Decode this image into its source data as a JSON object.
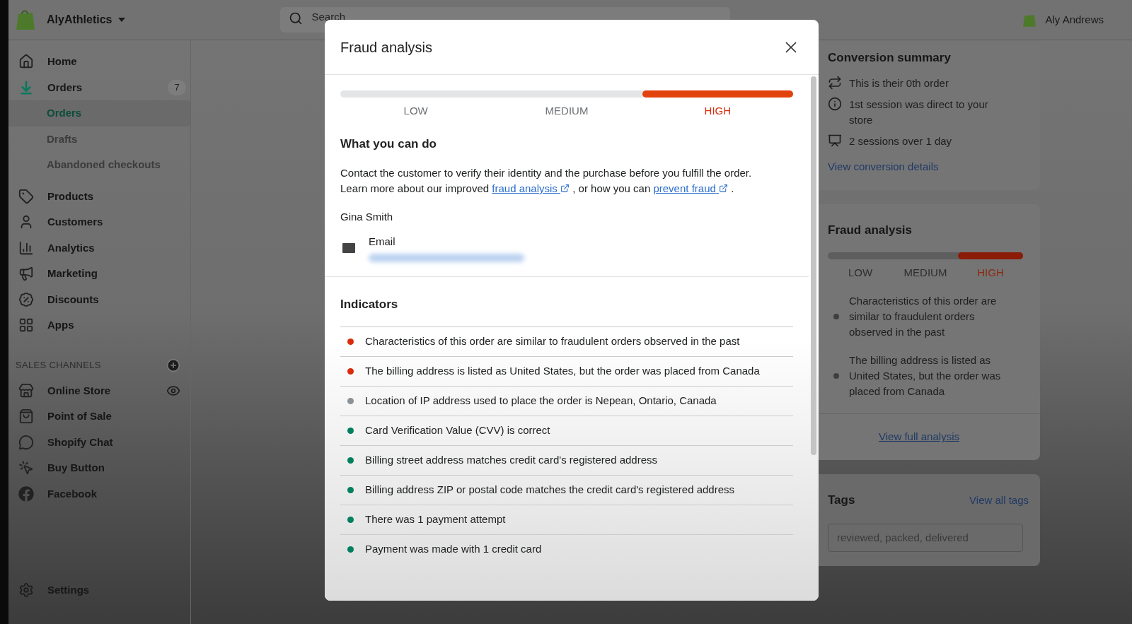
{
  "top_bar": {
    "store_name": "AlyAthletics",
    "search": {
      "placeholder": "Search"
    },
    "user_name": "Aly Andrews"
  },
  "sidebar": {
    "items": [
      {
        "label": "Home",
        "selected": false
      },
      {
        "label": "Orders",
        "selected": true,
        "badge": "7",
        "children": [
          {
            "label": "Orders",
            "selected": true
          },
          {
            "label": "Drafts",
            "selected": false
          },
          {
            "label": "Abandoned checkouts",
            "selected": false
          }
        ]
      },
      {
        "label": "Products",
        "selected": false
      },
      {
        "label": "Customers",
        "selected": false
      },
      {
        "label": "Analytics",
        "selected": false
      },
      {
        "label": "Marketing",
        "selected": false
      },
      {
        "label": "Discounts",
        "selected": false
      },
      {
        "label": "Apps",
        "selected": false
      }
    ],
    "sales_channels": {
      "heading": "SALES CHANNELS",
      "items": [
        {
          "label": "Online Store"
        },
        {
          "label": "Point of Sale"
        },
        {
          "label": "Shopify Chat"
        },
        {
          "label": "Buy Button"
        },
        {
          "label": "Facebook"
        }
      ]
    },
    "settings": "Settings"
  },
  "conversion_summary": {
    "title": "Conversion summary",
    "items": [
      "This is their 0th order",
      "1st session was direct to your store",
      "2 sessions over 1 day"
    ],
    "link": "View conversion details"
  },
  "fraud_card": {
    "title": "Fraud analysis",
    "risk_levels": [
      {
        "label": "LOW",
        "selected": false
      },
      {
        "label": "MEDIUM",
        "selected": false
      },
      {
        "label": "HIGH",
        "selected": true
      }
    ],
    "indicators": [
      "Characteristics of this order are similar to fraudulent orders observed in the past",
      "The billing address is listed as United States, but the order was placed from Canada"
    ],
    "link": "View full analysis"
  },
  "tags_card": {
    "title": "Tags",
    "link": "View all tags",
    "field": {
      "placeholder": "reviewed, packed, delivered"
    }
  },
  "modal": {
    "title": "Fraud analysis",
    "risk_levels": [
      {
        "label": "LOW",
        "selected": false
      },
      {
        "label": "MEDIUM",
        "selected": false
      },
      {
        "label": "HIGH",
        "selected": true
      }
    ],
    "what_you_can_do": {
      "heading": "What you can do",
      "parts": [
        {
          "kind": "text",
          "text": "Contact the customer to verify their identity and the purchase before you fulfill the order. Learn more about our improved "
        },
        {
          "kind": "link",
          "text": "fraud analysis"
        },
        {
          "kind": "text",
          "text": " , or how you can "
        },
        {
          "kind": "link",
          "text": "prevent fraud"
        },
        {
          "kind": "text",
          "text": " ."
        }
      ]
    },
    "customer_name": "Gina Smith",
    "email_label": "Email",
    "indicators": {
      "heading": "Indicators",
      "items": [
        {
          "text": "Characteristics of this order are similar to fraudulent orders observed in the past",
          "color": "#d82c0d"
        },
        {
          "text": "The billing address is listed as United States, but the order was placed from Canada",
          "color": "#d82c0d"
        },
        {
          "text": "Location of IP address used to place the order is Nepean, Ontario, Canada",
          "color": "#8c9196"
        },
        {
          "text": "Card Verification Value (CVV) is correct",
          "color": "#007f5f"
        },
        {
          "text": "Billing street address matches credit card's registered address",
          "color": "#007f5f"
        },
        {
          "text": "Billing address ZIP or postal code matches the credit card's registered address",
          "color": "#007f5f"
        },
        {
          "text": "There was 1 payment attempt",
          "color": "#007f5f"
        },
        {
          "text": "Payment was made with 1 credit card",
          "color": "#007f5f"
        }
      ]
    }
  }
}
